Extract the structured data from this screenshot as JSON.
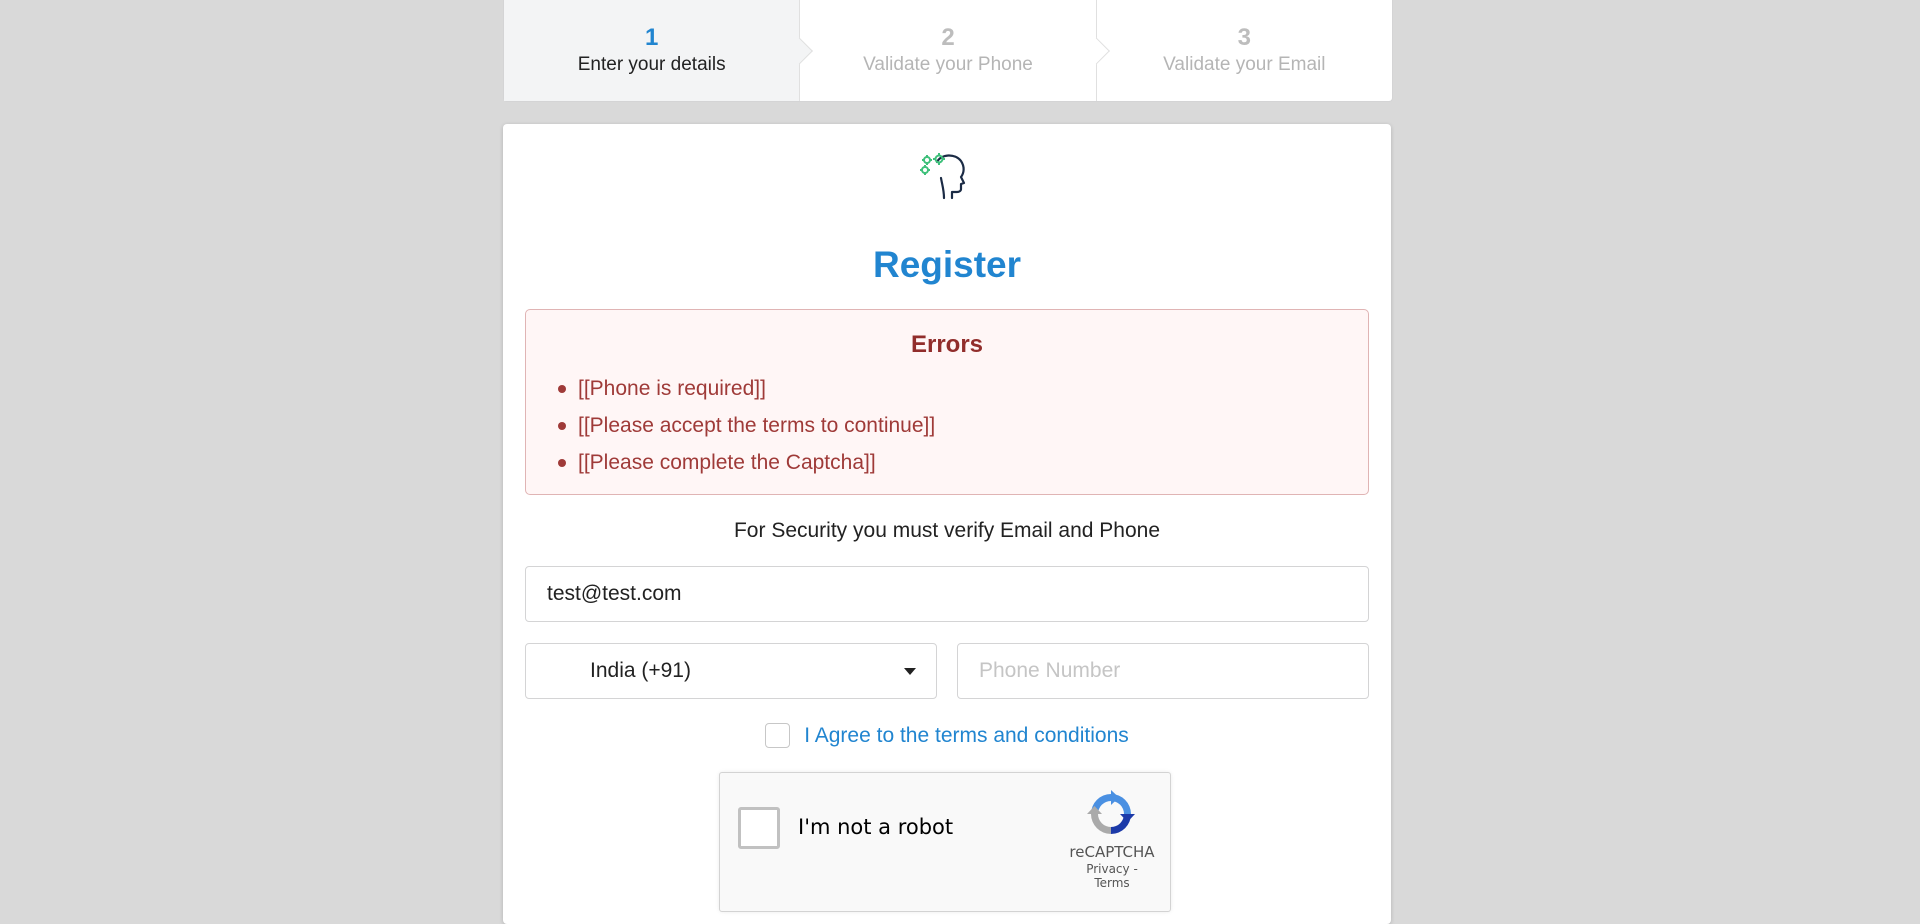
{
  "stepper": {
    "steps": [
      {
        "number": "1",
        "title": "Enter your details",
        "state": "active"
      },
      {
        "number": "2",
        "title": "Validate your Phone",
        "state": "disabled"
      },
      {
        "number": "3",
        "title": "Validate your Email",
        "state": "disabled"
      }
    ]
  },
  "card": {
    "logo_icon": "head-gears-icon",
    "title": "Register",
    "errors": {
      "header": "Errors",
      "items": [
        "[[Phone is required]]",
        "[[Please accept the terms to continue]]",
        "[[Please complete the Captcha]]"
      ]
    },
    "security_text": "For Security you must verify Email and Phone",
    "email_value": "test@test.com",
    "country_value": "India (+91)",
    "phone_placeholder": "Phone Number",
    "agree_label": "I Agree to the terms and conditions",
    "recaptcha": {
      "label": "I'm not a robot",
      "brand": "reCAPTCHA",
      "privacy": "Privacy",
      "separator": "-",
      "terms": "Terms"
    }
  },
  "colors": {
    "primary": "#2185d0",
    "error_text": "#9f3a38",
    "error_bg": "#fff6f6",
    "page_bg": "#d9d9d9"
  }
}
